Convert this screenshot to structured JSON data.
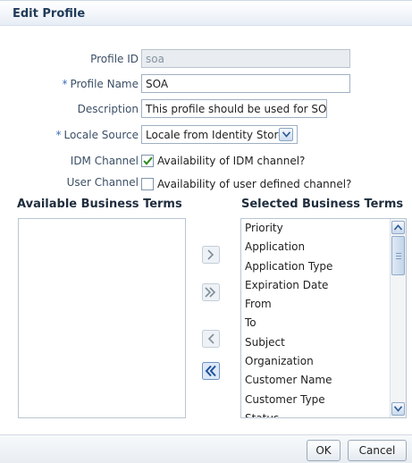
{
  "title": "Edit Profile",
  "form": {
    "profile_id": {
      "label": "Profile ID",
      "value": "soa"
    },
    "profile_name": {
      "required_mark": "*",
      "label": "Profile Name",
      "value": "SOA"
    },
    "description": {
      "label": "Description",
      "value": "This profile should be used for SOA"
    },
    "locale_source": {
      "required_mark": "*",
      "label": "Locale Source",
      "value": "Locale from Identity Store"
    },
    "idm_channel": {
      "label": "IDM Channel",
      "checkbox_label": "Availability of IDM channel?",
      "checked": true
    },
    "user_channel": {
      "label": "User Channel",
      "checkbox_label": "Availability of user defined channel?",
      "checked": false
    }
  },
  "shuttle": {
    "available_header": "Available Business Terms",
    "selected_header": "Selected Business Terms",
    "available_items": [],
    "selected_items": [
      "Priority",
      "Application",
      "Application Type",
      "Expiration Date",
      "From",
      "To",
      "Subject",
      "Organization",
      "Customer Name",
      "Customer Type",
      "Status"
    ],
    "buttons": {
      "move": "move-right-icon",
      "move_all": "move-all-right-icon",
      "remove": "move-left-icon",
      "remove_all": "move-all-left-icon"
    }
  },
  "footer": {
    "ok_label": "OK",
    "cancel_label": "Cancel"
  },
  "colors": {
    "title": "#1f3a59",
    "required": "#3a6bb8",
    "label": "#3c4f66",
    "check": "#2e8b1e"
  }
}
